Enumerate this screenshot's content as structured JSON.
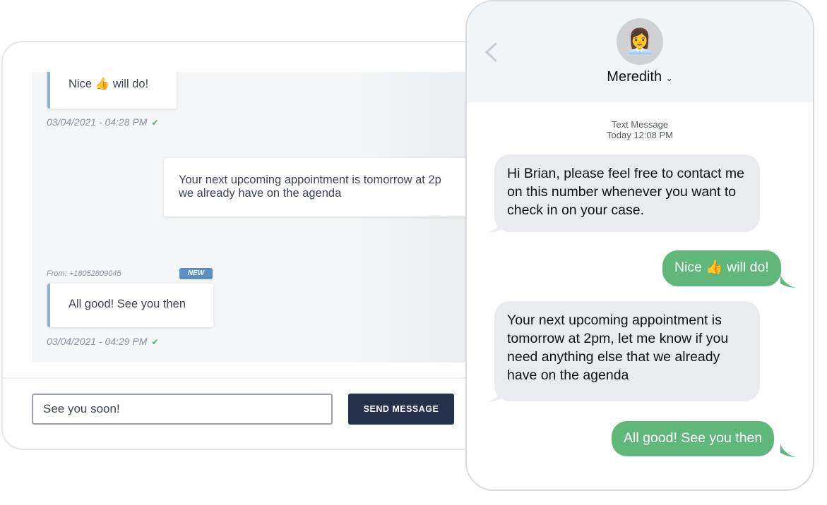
{
  "dashboard": {
    "messages": [
      {
        "text": "Nice 👍 will do!",
        "direction": "incoming",
        "timestamp": "03/04/2021 - 04:28 PM",
        "status": "delivered"
      },
      {
        "text_line1": "Your next upcoming appointment is tomorrow at 2p",
        "text_line2": "we already have on the agenda",
        "direction": "outgoing"
      },
      {
        "from": "From: +18052809045",
        "badge": "NEW",
        "text": "All good! See you then",
        "direction": "incoming",
        "timestamp": "03/04/2021 - 04:29 PM",
        "status": "delivered"
      }
    ],
    "check_icon": "✔",
    "input_value": "See you soon!",
    "send_label": "SEND MESSAGE"
  },
  "phone": {
    "contact_name": "Meredith",
    "avatar": "👩‍💼",
    "meta_label": "Text Message",
    "meta_time": "Today 12:08 PM",
    "messages": [
      {
        "text": "Hi Brian, please feel free to contact me on this number whenever you want to check in on your case.",
        "direction": "received"
      },
      {
        "text": "Nice 👍 will do!",
        "direction": "sent"
      },
      {
        "text": "Your next upcoming appointment is tomorrow at 2pm, let me know if you need anything else that we already have on the agenda",
        "direction": "received"
      },
      {
        "text": "All good! See you then",
        "direction": "sent"
      }
    ]
  },
  "colors": {
    "sent": "#5fb87a",
    "received": "#e9ebee",
    "button": "#25304a",
    "badge": "#5b8fc2",
    "accent_bar": "#8fb0d0"
  }
}
